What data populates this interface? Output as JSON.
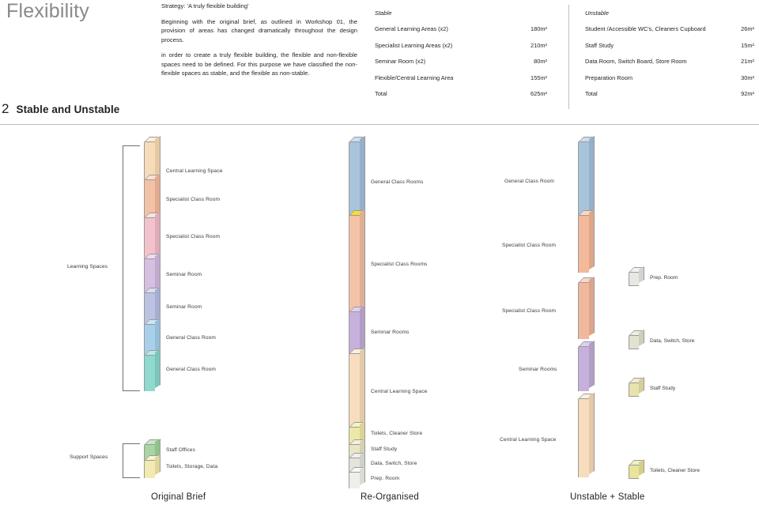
{
  "header": {
    "title": "Flexibility",
    "section_number": "2",
    "section_title": "Stable and Unstable",
    "strategy_line": "Strategy: 'A truly flexible building'",
    "paragraph_1": "Beginning with the original brief, as outlined in Workshop 01, the provision of areas has changed dramatically throughout the design process.",
    "paragraph_2": "in order to create a truly flexible building, the flexible and non-flexible spaces need to be defined. For this purpose we have classified the non-flexible spaces as stable, and the flexible as non-stable."
  },
  "tables": {
    "stable": {
      "caption": "Stable",
      "rows": [
        {
          "label": "General Learning Areas (x2)",
          "value": "180m²"
        },
        {
          "label": "Specialist Learning Areas (x2)",
          "value": "210m²"
        },
        {
          "label": "Seminar Room (x2)",
          "value": "80m²"
        },
        {
          "label": "Flexible/Central Learning Area",
          "value": "155m²"
        },
        {
          "label": "Total",
          "value": "625m²"
        }
      ]
    },
    "unstable": {
      "caption": "Unstable",
      "rows": [
        {
          "label": "Student /Accessible WC's, Cleaners Cupboard",
          "value": "26m²"
        },
        {
          "label": "Staff Study",
          "value": "15m²"
        },
        {
          "label": "Data Room, Switch Board, Store Room",
          "value": "21m²"
        },
        {
          "label": "Preparation Room",
          "value": "30m²"
        },
        {
          "label": "Total",
          "value": "92m²"
        }
      ]
    }
  },
  "diagram": {
    "captions": {
      "col1": "Original Brief",
      "col2": "Re-Organised",
      "col3": "Unstable  +  Stable"
    },
    "col1": {
      "group_learning_label": "Learning Spaces",
      "group_support_label": "Support Spaces",
      "learning_segments": [
        {
          "label": "Central Learning Space",
          "color": "#f6dcb8",
          "top_color": "#fdf0dd",
          "side_color": "#e6c8a2"
        },
        {
          "label": "Specialist Class Room",
          "color": "#f3c1a4",
          "top_color": "#fbe0d0",
          "side_color": "#e0ab8e"
        },
        {
          "label": "Specialist Class Room",
          "color": "#f2c3cd",
          "top_color": "#fbe1e7",
          "side_color": "#deadb8"
        },
        {
          "label": "Seminar Room",
          "color": "#d6bfe0",
          "top_color": "#ecddf2",
          "side_color": "#c2aacd"
        },
        {
          "label": "Seminar Room",
          "color": "#bcc2e2",
          "top_color": "#d9ddf0",
          "side_color": "#a8aecf"
        },
        {
          "label": "General Class Room",
          "color": "#a9d0ea",
          "top_color": "#cde5f5",
          "side_color": "#96bcd7"
        },
        {
          "label": "General Class Room",
          "color": "#8fd9cf",
          "top_color": "#bceae3",
          "side_color": "#7cc5bb"
        }
      ],
      "support_segments": [
        {
          "label": "Staff Offices",
          "color": "#a8d5a2",
          "top_color": "#c8e7c4",
          "side_color": "#93c08d"
        },
        {
          "label": "Toilets, Storage, Data",
          "color": "#f2eab0",
          "top_color": "#f8f3d1",
          "side_color": "#ded69c"
        }
      ]
    },
    "col2": {
      "segments": [
        {
          "label": "General Class Rooms",
          "color": "#a8c4dd",
          "top_color": "#cddeec",
          "side_color": "#95b0c8"
        },
        {
          "label": "Specialist Class Rooms",
          "color": "#f2c3a6",
          "top_color": "#fade2c",
          "side_color": "#deaf92"
        },
        {
          "label": "Seminar Rooms",
          "color": "#c6b1dc",
          "top_color": "#ded0ee",
          "side_color": "#b29dc7"
        },
        {
          "label": "Central Learning Space",
          "color": "#f7ddbd",
          "top_color": "#fdf0dd",
          "side_color": "#e3c9a8"
        },
        {
          "label": "Toilets, Cleaner Store",
          "color": "#eee8a8",
          "top_color": "#f6f2c9",
          "side_color": "#dad494"
        },
        {
          "label": "Staff Study",
          "color": "#e9e6c4",
          "top_color": "#f3f1dd",
          "side_color": "#d5d2b0"
        },
        {
          "label": "Data, Switch, Store",
          "color": "#e4e3dc",
          "top_color": "#f0efeb",
          "side_color": "#d0cfc8"
        },
        {
          "label": "Prep. Room",
          "color": "#eeeeea",
          "top_color": "#f8f8f6",
          "side_color": "#dadad6"
        }
      ]
    },
    "col3": {
      "segments": [
        {
          "label": "General Class Room",
          "color": "#a8c4dd",
          "top_color": "#cddeec",
          "side_color": "#95b0c8"
        },
        {
          "label": "Specialist Class Room",
          "color": "#f2b99b",
          "top_color": "#fad8c6",
          "side_color": "#dea587"
        },
        {
          "label": "Specialist Class Room",
          "color": "#f0b99e",
          "top_color": "#fad9c8",
          "side_color": "#dca58b"
        },
        {
          "label": "Seminar Rooms",
          "color": "#c6b1dc",
          "top_color": "#ded0ee",
          "side_color": "#b29dc7"
        },
        {
          "label": "Central Learning Space",
          "color": "#f7ddbd",
          "top_color": "#fdf0dd",
          "side_color": "#e3c9a8"
        }
      ],
      "cubes": [
        {
          "label": "Prep. Room",
          "color": "#e8e8e2",
          "top_color": "#f4f4f0",
          "side_color": "#d4d4ce"
        },
        {
          "label": "Data, Switch, Store",
          "color": "#e3e1cf",
          "top_color": "#eeedde",
          "side_color": "#cfcdbb"
        },
        {
          "label": "Staff Study",
          "color": "#e7e3ae",
          "top_color": "#f1eecc",
          "side_color": "#d3cf9a"
        },
        {
          "label": "Toilets, Cleaner Store",
          "color": "#e9e49a",
          "top_color": "#f2efc1",
          "side_color": "#d5d086"
        }
      ]
    }
  }
}
